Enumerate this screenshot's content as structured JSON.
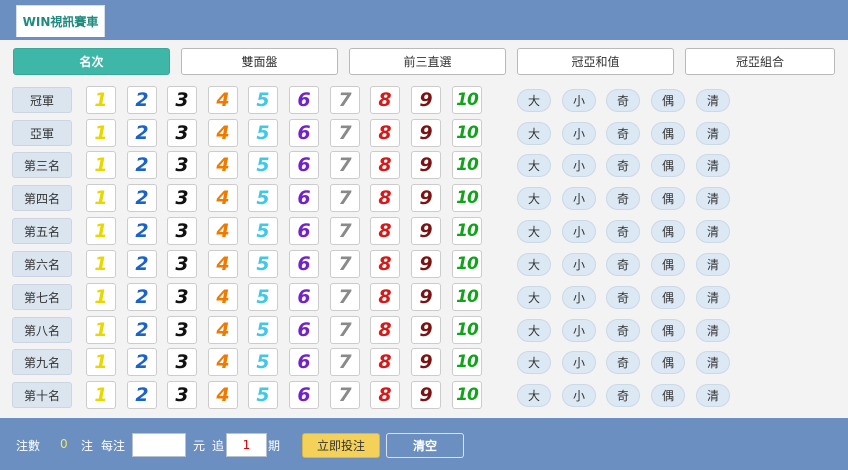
{
  "app": {
    "title": "WIN視訊賽車"
  },
  "tabs": [
    {
      "label": "名次",
      "active": true
    },
    {
      "label": "雙面盤",
      "active": false
    },
    {
      "label": "前三直選",
      "active": false
    },
    {
      "label": "冠亞和值",
      "active": false
    },
    {
      "label": "冠亞組合",
      "active": false
    }
  ],
  "rows": [
    "冠軍",
    "亞軍",
    "第三名",
    "第四名",
    "第五名",
    "第六名",
    "第七名",
    "第八名",
    "第九名",
    "第十名"
  ],
  "numbers": [
    "1",
    "2",
    "3",
    "4",
    "5",
    "6",
    "7",
    "8",
    "9",
    "10"
  ],
  "number_colors": [
    "#e8d800",
    "#1a63c9",
    "#111111",
    "#ee7a00",
    "#3fc8e8",
    "#7322c9",
    "#8a8a8a",
    "#d61a1a",
    "#7a1414",
    "#11a31a"
  ],
  "options": [
    "大",
    "小",
    "奇",
    "偶",
    "清"
  ],
  "footer": {
    "count_label": "注數",
    "count_value": "0",
    "unit_label": "注",
    "per_bet_label": "每注",
    "amount_value": "",
    "currency_label": "元",
    "chase_label": "追",
    "chase_value": "1",
    "period_label": "期",
    "bet_button": "立即投注",
    "clear_button": "清空"
  }
}
